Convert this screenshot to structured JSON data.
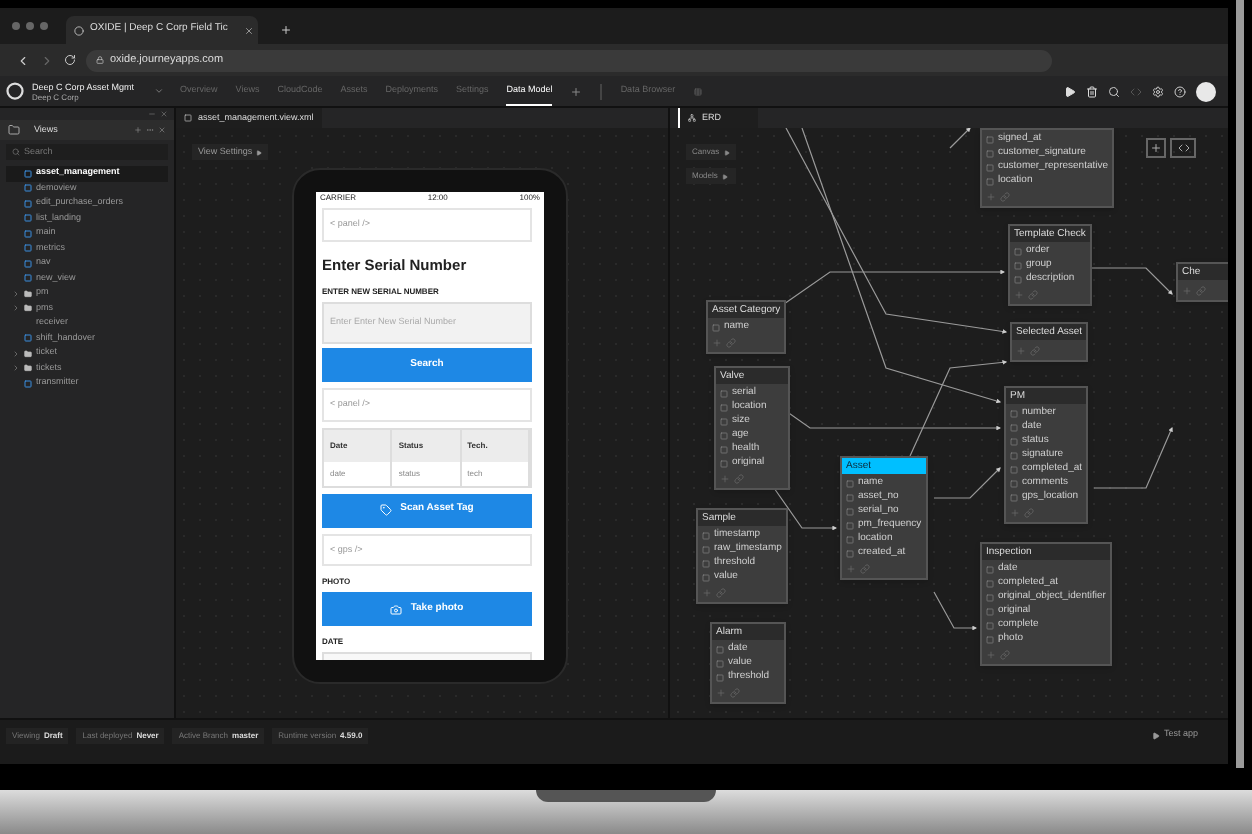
{
  "browser": {
    "tab_title": "OXIDE | Deep C Corp Field Tic",
    "url": "oxide.journeyapps.com"
  },
  "app_header": {
    "project_name": "Deep C Corp Asset Mgmt",
    "org": "Deep C Corp",
    "tabs": [
      {
        "label": "Overview",
        "selected": false
      },
      {
        "label": "Views",
        "selected": false
      },
      {
        "label": "CloudCode",
        "selected": false
      },
      {
        "label": "Assets",
        "selected": false
      },
      {
        "label": "Deployments",
        "selected": false
      },
      {
        "label": "Settings",
        "selected": false
      },
      {
        "label": "Data Model",
        "selected": true
      }
    ],
    "data_browser": "Data Browser"
  },
  "sidebar": {
    "title": "Views",
    "search": {
      "placeholder": "Search"
    },
    "items": [
      {
        "label": "asset_management",
        "kind": "view",
        "selected": true
      },
      {
        "label": "demoview",
        "kind": "view",
        "selected": false
      },
      {
        "label": "edit_purchase_orders",
        "kind": "view",
        "selected": false
      },
      {
        "label": "list_landing",
        "kind": "view",
        "selected": false
      },
      {
        "label": "main",
        "kind": "view",
        "selected": false
      },
      {
        "label": "metrics",
        "kind": "view",
        "selected": false
      },
      {
        "label": "nav",
        "kind": "view",
        "selected": false
      },
      {
        "label": "new_view",
        "kind": "view",
        "selected": false
      },
      {
        "label": "pm",
        "kind": "folder",
        "selected": false
      },
      {
        "label": "pms",
        "kind": "folder",
        "selected": false
      },
      {
        "label": "receiver",
        "kind": "item",
        "selected": false
      },
      {
        "label": "shift_handover",
        "kind": "view",
        "selected": false
      },
      {
        "label": "ticket",
        "kind": "folder",
        "selected": false
      },
      {
        "label": "tickets",
        "kind": "folder",
        "selected": false
      },
      {
        "label": "transmitter",
        "kind": "view",
        "selected": false
      }
    ]
  },
  "editor": {
    "file_tab": "asset_management.view.xml",
    "view_settings": "View Settings",
    "phone": {
      "carrier": "CARRIER",
      "time": "12:00",
      "battery": "100%",
      "components": [
        {
          "kind": "placeholder",
          "text": "< panel />"
        },
        {
          "kind": "heading",
          "text": "Enter Serial Number"
        },
        {
          "kind": "label",
          "text": "ENTER NEW SERIAL NUMBER"
        },
        {
          "kind": "input",
          "placeholder": "Enter Enter New Serial Number"
        },
        {
          "kind": "button",
          "text": "Search"
        },
        {
          "kind": "placeholder",
          "text": "< panel />"
        },
        {
          "kind": "table",
          "columns": [
            "Date",
            "Status",
            "Tech."
          ],
          "row": [
            "date",
            "status",
            "tech"
          ]
        },
        {
          "kind": "scan_button",
          "text": "Scan Asset Tag"
        },
        {
          "kind": "placeholder",
          "text": "< gps />"
        },
        {
          "kind": "label",
          "text": "PHOTO"
        },
        {
          "kind": "photo_button",
          "text": "Take photo"
        },
        {
          "kind": "label",
          "text": "DATE"
        },
        {
          "kind": "date_field"
        }
      ]
    }
  },
  "erd": {
    "tab": "ERD",
    "menu": [
      "Canvas",
      "Models"
    ],
    "models": [
      {
        "fields": [
          "signed_at",
          "customer_signature",
          "customer_representative",
          "location"
        ]
      },
      {
        "name": "Template Check",
        "highlighted": false,
        "fields": [
          "order",
          "group",
          "description"
        ]
      },
      {
        "name": "Che",
        "highlighted": false
      },
      {
        "name": "Selected Asset",
        "highlighted": false
      },
      {
        "name": "Asset Category",
        "highlighted": false,
        "fields": [
          "name"
        ]
      },
      {
        "name": "Valve",
        "highlighted": false,
        "fields": [
          "serial",
          "location",
          "size",
          "age",
          "health",
          "original"
        ]
      },
      {
        "name": "PM",
        "highlighted": false,
        "fields": [
          "number",
          "date",
          "status",
          "signature",
          "completed_at",
          "comments",
          "gps_location"
        ]
      },
      {
        "name": "Asset",
        "highlighted": true,
        "fields": [
          "name",
          "asset_no",
          "serial_no",
          "pm_frequency",
          "location",
          "created_at"
        ]
      },
      {
        "name": "Sample",
        "highlighted": false,
        "fields": [
          "timestamp",
          "raw_timestamp",
          "threshold",
          "value"
        ]
      },
      {
        "name": "Inspection",
        "highlighted": false,
        "fields": [
          "date",
          "completed_at",
          "original_object_identifier",
          "original",
          "complete",
          "photo"
        ]
      },
      {
        "name": "Alarm",
        "highlighted": false,
        "fields": [
          "date",
          "value",
          "threshold"
        ]
      }
    ]
  },
  "status_bar": [
    {
      "label": "Viewing",
      "value": "Draft"
    },
    {
      "label": "Last deployed",
      "value": "Never"
    },
    {
      "label": "Active Branch",
      "value": "master"
    },
    {
      "label": "Runtime version",
      "value": "4.59.0"
    }
  ],
  "test_app": "Test app"
}
